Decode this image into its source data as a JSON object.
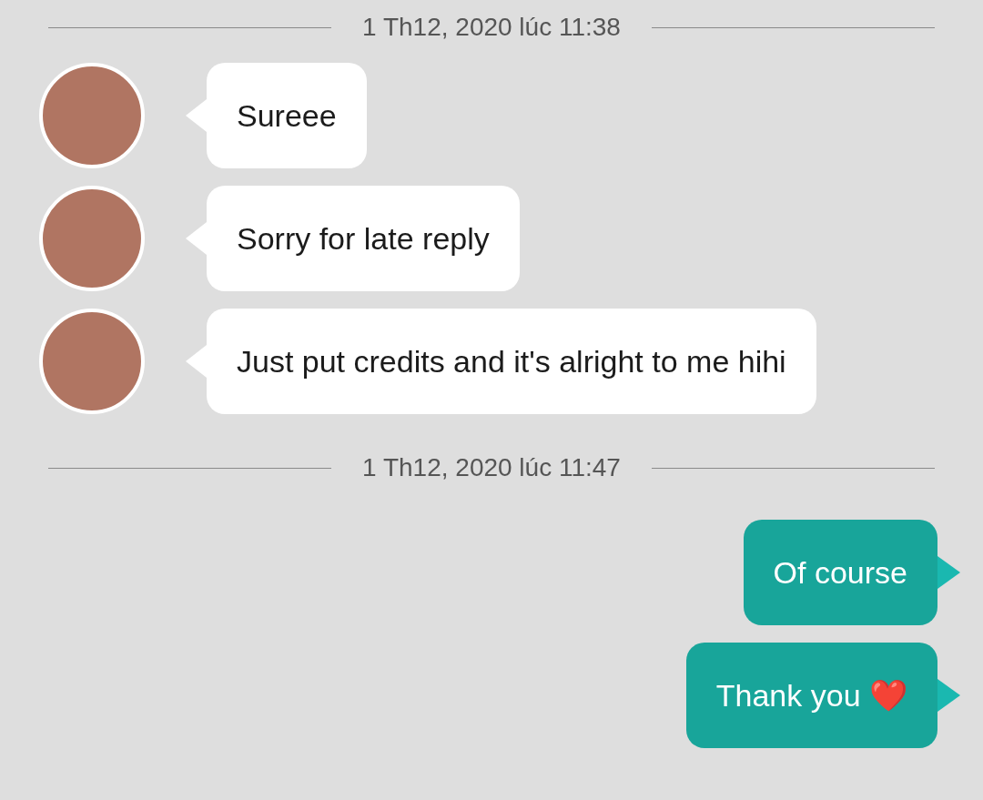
{
  "conversation": [
    {
      "kind": "timestamp",
      "text": "1 Th12, 2020 lúc 11:38"
    },
    {
      "kind": "incoming",
      "text": "Sureee"
    },
    {
      "kind": "incoming",
      "text": "Sorry for late reply"
    },
    {
      "kind": "incoming",
      "text": "Just put credits and it's alright to me hihi"
    },
    {
      "kind": "timestamp",
      "text": "1 Th12, 2020 lúc 11:47"
    },
    {
      "kind": "outgoing",
      "text": "Of course"
    },
    {
      "kind": "outgoing",
      "text": "Thank you ❤️"
    }
  ]
}
